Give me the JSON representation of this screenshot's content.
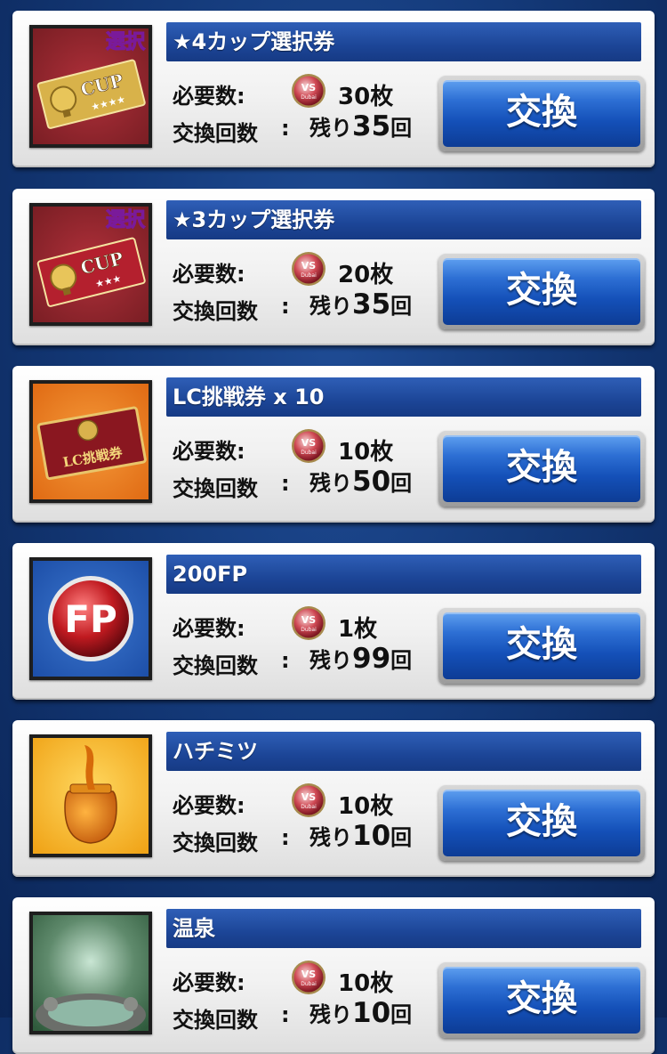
{
  "labels": {
    "required": "必要数:",
    "exchange_count": "交換回数",
    "colon": ":",
    "remaining_prefix": "残り",
    "remaining_suffix": "回",
    "cost_suffix": "枚",
    "button": "交換",
    "coin_text_top": "VS",
    "coin_text_bottom": "Dubai"
  },
  "items": [
    {
      "title": "★4カップ選択券",
      "cost": "30",
      "remaining": "35",
      "icon": "cup-ticket-4star-icon",
      "thumb_badge": "選択",
      "thumb_text": "CUP",
      "thumb_stars": "★★★★",
      "thumb_bg": "#7a1e24",
      "ticket_color": "#d8b24a"
    },
    {
      "title": "★3カップ選択券",
      "cost": "20",
      "remaining": "35",
      "icon": "cup-ticket-3star-icon",
      "thumb_badge": "選択",
      "thumb_text": "CUP",
      "thumb_stars": "★★★",
      "thumb_bg": "#7a1e24",
      "ticket_color": "#b4202e"
    },
    {
      "title": "LC挑戦券 x 10",
      "cost": "10",
      "remaining": "50",
      "icon": "lc-challenge-ticket-icon",
      "thumb_text": "LC挑戦券",
      "thumb_bg": "#e06b14",
      "ticket_color": "#8a1720"
    },
    {
      "title": "200FP",
      "cost": "1",
      "remaining": "99",
      "icon": "fp-icon",
      "thumb_text": "FP",
      "thumb_bg": "#1d4fa8",
      "ticket_color": "#c01a20"
    },
    {
      "title": "ハチミツ",
      "cost": "10",
      "remaining": "10",
      "icon": "honey-jar-icon",
      "thumb_bg": "#f0a418",
      "ticket_color": "#e07a12"
    },
    {
      "title": "温泉",
      "cost": "10",
      "remaining": "10",
      "icon": "hot-spring-icon",
      "thumb_bg": "#2f5a3c",
      "ticket_color": "#8fb8a6"
    }
  ]
}
